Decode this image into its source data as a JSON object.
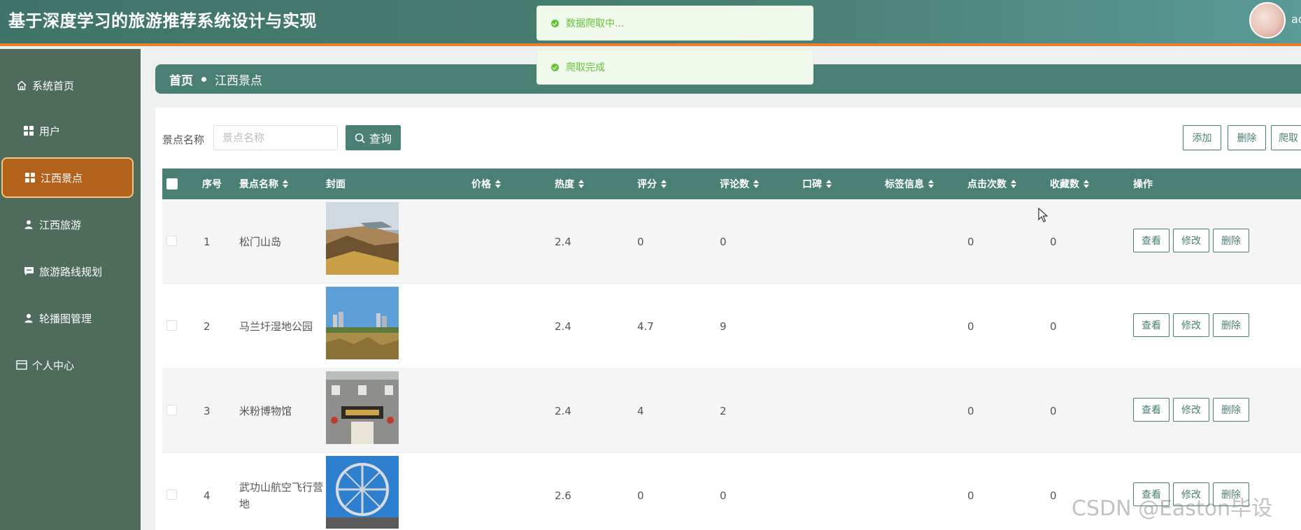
{
  "header": {
    "title": "基于深度学习的旅游推荐系统设计与实现",
    "username": "ac"
  },
  "sidebar": {
    "items": [
      {
        "label": "系统首页",
        "icon": "home-icon"
      },
      {
        "label": "用户",
        "icon": "grid-icon"
      },
      {
        "label": "江西景点",
        "icon": "grid-icon",
        "active": true
      },
      {
        "label": "江西旅游",
        "icon": "user-icon"
      },
      {
        "label": "旅游路线规划",
        "icon": "chat-icon"
      },
      {
        "label": "轮播图管理",
        "icon": "user-icon"
      },
      {
        "label": "个人中心",
        "icon": "card-icon"
      }
    ]
  },
  "breadcrumb": {
    "home": "首页",
    "current": "江西景点"
  },
  "search": {
    "label": "景点名称",
    "placeholder": "景点名称",
    "value": "",
    "button": "查询"
  },
  "toolbar": {
    "add": "添加",
    "delete": "删除",
    "crawl": "爬取"
  },
  "table": {
    "headers": {
      "index": "序号",
      "name": "景点名称",
      "cover": "封面",
      "price": "价格",
      "heat": "热度",
      "score": "评分",
      "comments": "评论数",
      "reputation": "口碑",
      "tags": "标签信息",
      "clicks": "点击次数",
      "favorites": "收藏数",
      "ops": "操作"
    },
    "actions": {
      "view": "查看",
      "edit": "修改",
      "delete": "删除"
    },
    "rows": [
      {
        "index": "1",
        "name": "松门山岛",
        "price": "",
        "heat": "2.4",
        "score": "0",
        "comments": "0",
        "reputation": "",
        "tags": "",
        "clicks": "0",
        "favorites": "0"
      },
      {
        "index": "2",
        "name": "马兰圩湿地公园",
        "price": "",
        "heat": "2.4",
        "score": "4.7",
        "comments": "9",
        "reputation": "",
        "tags": "",
        "clicks": "0",
        "favorites": "0"
      },
      {
        "index": "3",
        "name": "米粉博物馆",
        "price": "",
        "heat": "2.4",
        "score": "4",
        "comments": "2",
        "reputation": "",
        "tags": "",
        "clicks": "0",
        "favorites": "0"
      },
      {
        "index": "4",
        "name": "武功山航空飞行营地",
        "price": "",
        "heat": "2.6",
        "score": "0",
        "comments": "0",
        "reputation": "",
        "tags": "",
        "clicks": "0",
        "favorites": "0"
      }
    ]
  },
  "toasts": [
    {
      "text": "数据爬取中..."
    },
    {
      "text": "爬取完成"
    }
  ],
  "watermark": "CSDN @Easton毕设",
  "colors": {
    "primary": "#4a7f74",
    "sidebar": "#4e6b5b",
    "active_item": "#b3621b",
    "header_border": "#ec7f2b",
    "toast_success": "#67c23a"
  }
}
